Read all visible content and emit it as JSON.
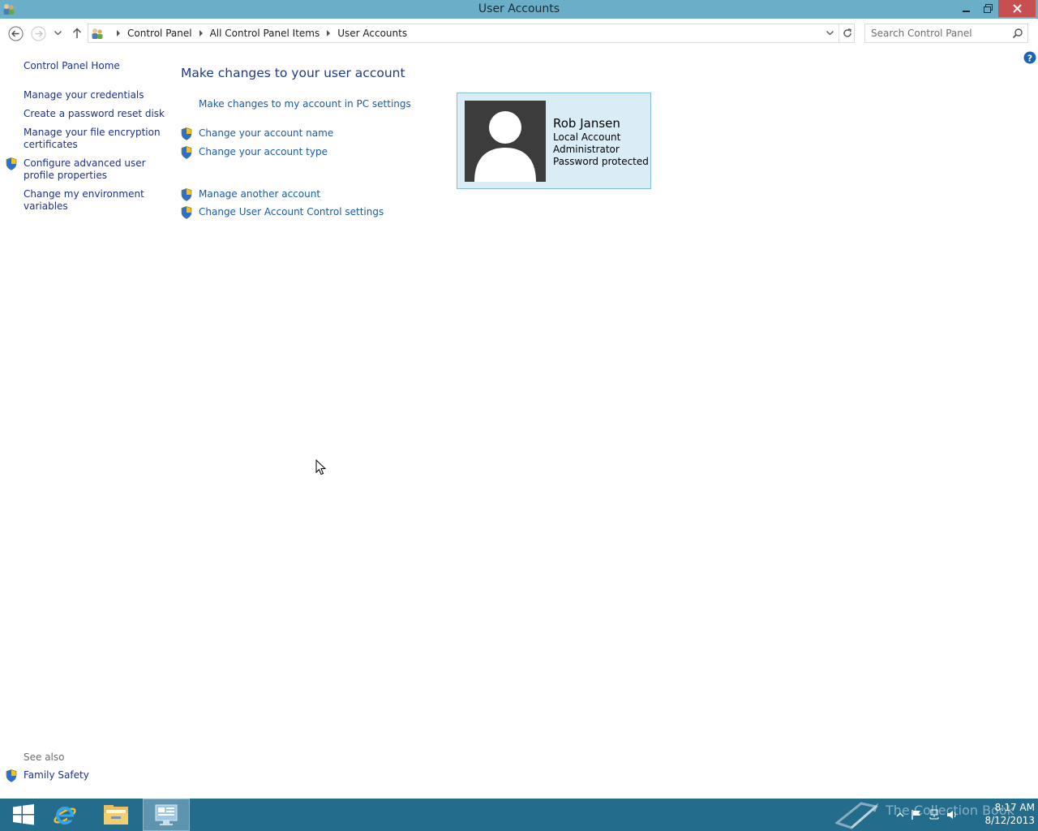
{
  "window": {
    "title": "User Accounts"
  },
  "address_bar": {
    "breadcrumbs": [
      "Control Panel",
      "All Control Panel Items",
      "User Accounts"
    ]
  },
  "search": {
    "placeholder": "Search Control Panel"
  },
  "sidebar": {
    "home": "Control Panel Home",
    "items": [
      {
        "label": "Manage your credentials",
        "shield": false
      },
      {
        "label": "Create a password reset disk",
        "shield": false
      },
      {
        "label_line1": "Manage your file encryption",
        "label_line2": "certificates",
        "shield": false
      },
      {
        "label_line1": "Configure advanced user",
        "label_line2": "profile properties",
        "shield": true
      },
      {
        "label_line1": "Change my environment",
        "label_line2": "variables",
        "shield": false
      }
    ],
    "see_also_label": "See also",
    "see_also_items": [
      {
        "label": "Family Safety",
        "shield": true
      }
    ]
  },
  "main": {
    "title": "Make changes to your user account",
    "links": [
      {
        "label": "Make changes to my account in PC settings",
        "shield": false
      },
      {
        "label": "Change your account name",
        "shield": true
      },
      {
        "label": "Change your account type",
        "shield": true
      },
      {
        "label": "Manage another account",
        "shield": true
      },
      {
        "label": "Change User Account Control settings",
        "shield": true
      }
    ]
  },
  "account": {
    "name": "Rob Jansen",
    "type": "Local Account",
    "role": "Administrator",
    "status": "Password protected"
  },
  "taskbar": {
    "apps": [
      "start-icon",
      "internet-explorer-icon",
      "file-explorer-icon",
      "control-panel-icon"
    ],
    "watermark": "The Collection Book",
    "time": "8:17 AM",
    "date": "8/12/2013"
  },
  "colors": {
    "titlebar": "#6aaec8",
    "taskbar": "#246c8c",
    "link": "#1e3287",
    "tile_bg": "#daedf7",
    "tile_border": "#84bddd"
  }
}
